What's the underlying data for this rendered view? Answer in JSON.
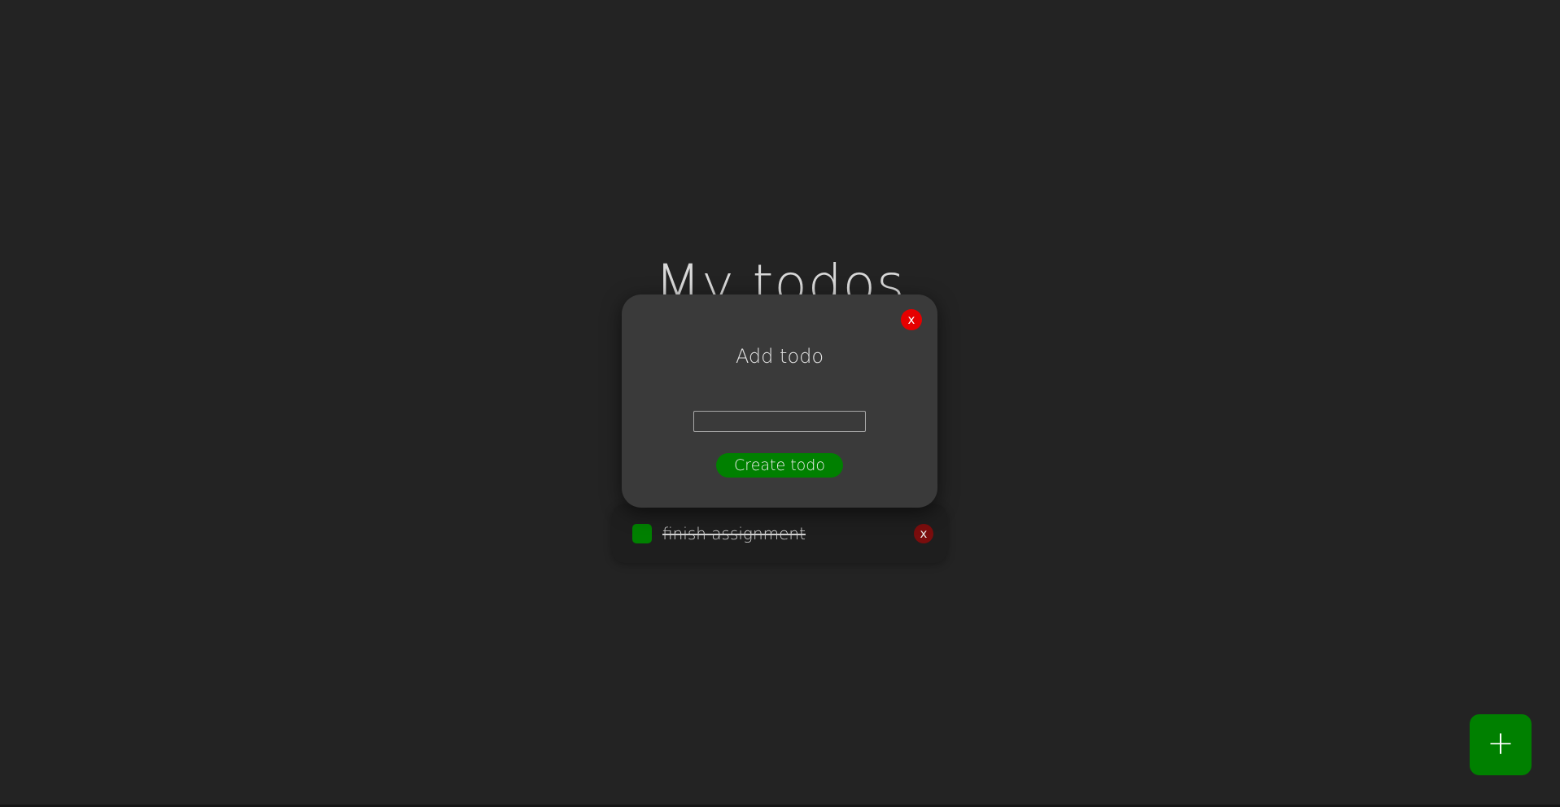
{
  "app": {
    "title": "My todos"
  },
  "todos": [
    {
      "text": "finish assignment",
      "completed": true,
      "delete_label": "x"
    }
  ],
  "modal": {
    "heading": "Add todo",
    "close_label": "x",
    "input_value": "",
    "input_placeholder": "",
    "submit_label": "Create todo"
  },
  "fab": {
    "label": "+"
  },
  "colors": {
    "background": "#232323",
    "accent": "#008000",
    "danger": "#e50000",
    "danger_muted": "#7a0d0d",
    "modal": "#3a3a3a"
  }
}
